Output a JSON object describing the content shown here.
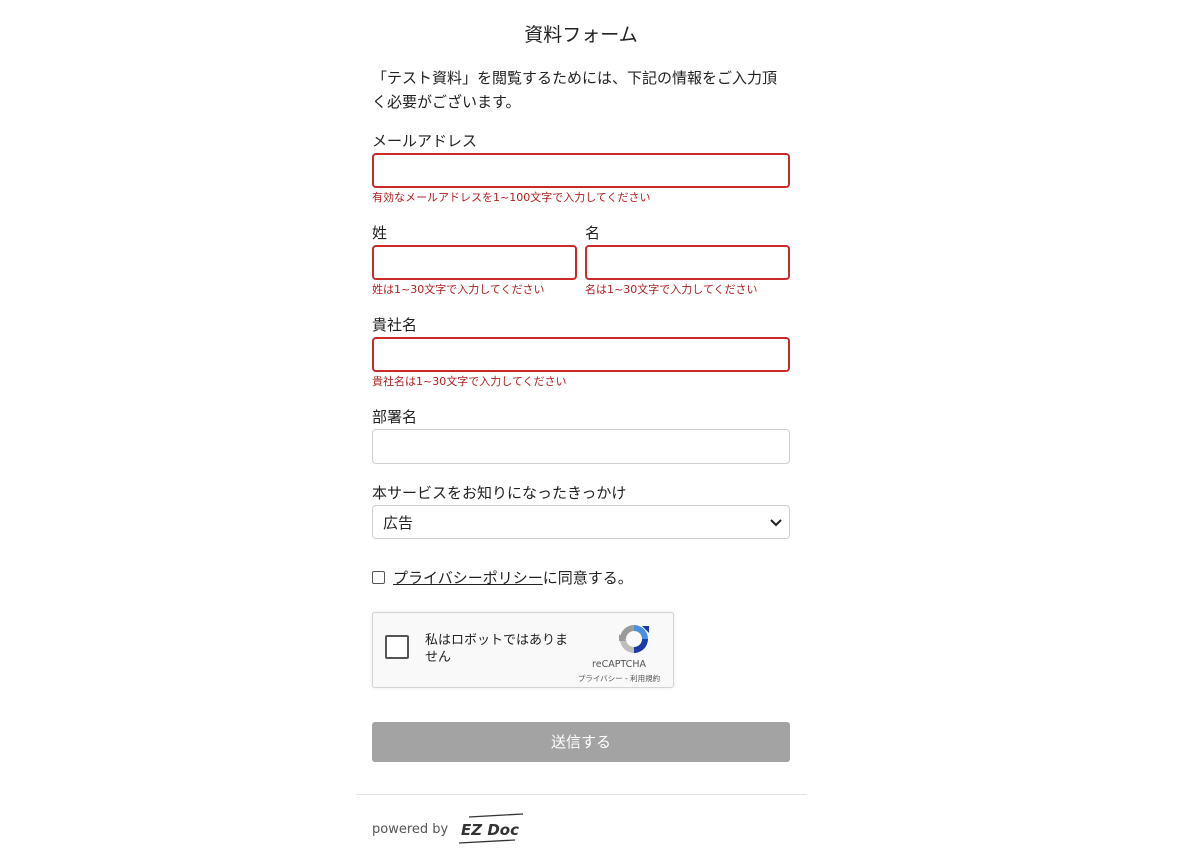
{
  "form": {
    "title": "資料フォーム",
    "intro": "「テスト資料」を閲覧するためには、下記の情報をご入力頂く必要がございます。"
  },
  "fields": {
    "email": {
      "label": "メールアドレス",
      "value": "",
      "error": "有効なメールアドレスを1~100文字で入力してください"
    },
    "last_name": {
      "label": "姓",
      "value": "",
      "error": "姓は1~30文字で入力してください"
    },
    "first_name": {
      "label": "名",
      "value": "",
      "error": "名は1~30文字で入力してください"
    },
    "company": {
      "label": "貴社名",
      "value": "",
      "error": "貴社名は1~30文字で入力してください"
    },
    "department": {
      "label": "部署名",
      "value": ""
    },
    "source": {
      "label": "本サービスをお知りになったきっかけ",
      "selected": "広告"
    }
  },
  "agree": {
    "link_text": "プライバシーポリシー",
    "suffix": "に同意する。",
    "checked": false
  },
  "recaptcha": {
    "label": "私はロボットではありません",
    "brand": "reCAPTCHA",
    "links": "プライバシー - 利用規約",
    "checked": false
  },
  "submit": {
    "label": "送信する"
  },
  "footer": {
    "powered_by": "powered by",
    "logo_text": "EZ Doc"
  },
  "colors": {
    "error": "#cc2a2a",
    "submit_disabled": "#a3a3a3"
  }
}
